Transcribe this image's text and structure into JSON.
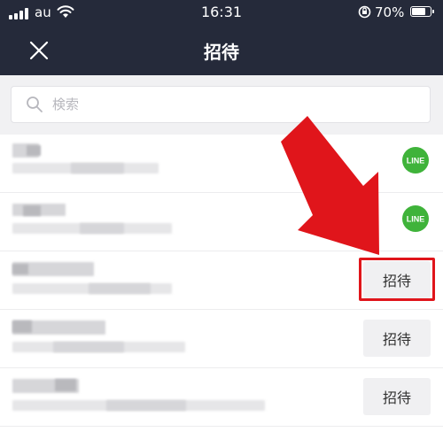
{
  "status_bar": {
    "carrier": "au",
    "time": "16:31",
    "battery_percent": "70%",
    "battery_level": 0.7
  },
  "header": {
    "title": "招待",
    "close_icon": "close-icon"
  },
  "search": {
    "placeholder": "検索",
    "value": ""
  },
  "contacts": [
    {
      "name": "",
      "status": "",
      "action": "line-badge"
    },
    {
      "name": "",
      "status": "",
      "action": "line-badge"
    },
    {
      "name": "",
      "status": "",
      "action": "invite",
      "invite_label": "招待",
      "highlighted": true
    },
    {
      "name": "",
      "status": "",
      "action": "invite",
      "invite_label": "招待"
    },
    {
      "name": "",
      "status": "",
      "action": "invite",
      "invite_label": "招待"
    }
  ],
  "line_badge": {
    "label": "LINE",
    "color": "#3fb33a"
  },
  "annotation": {
    "arrow_color": "#e0151b",
    "highlight_color": "#e0151b"
  },
  "colors": {
    "header_bg": "#252a3a",
    "search_bg": "#f1f1f3",
    "button_bg": "#f0f0f2"
  }
}
